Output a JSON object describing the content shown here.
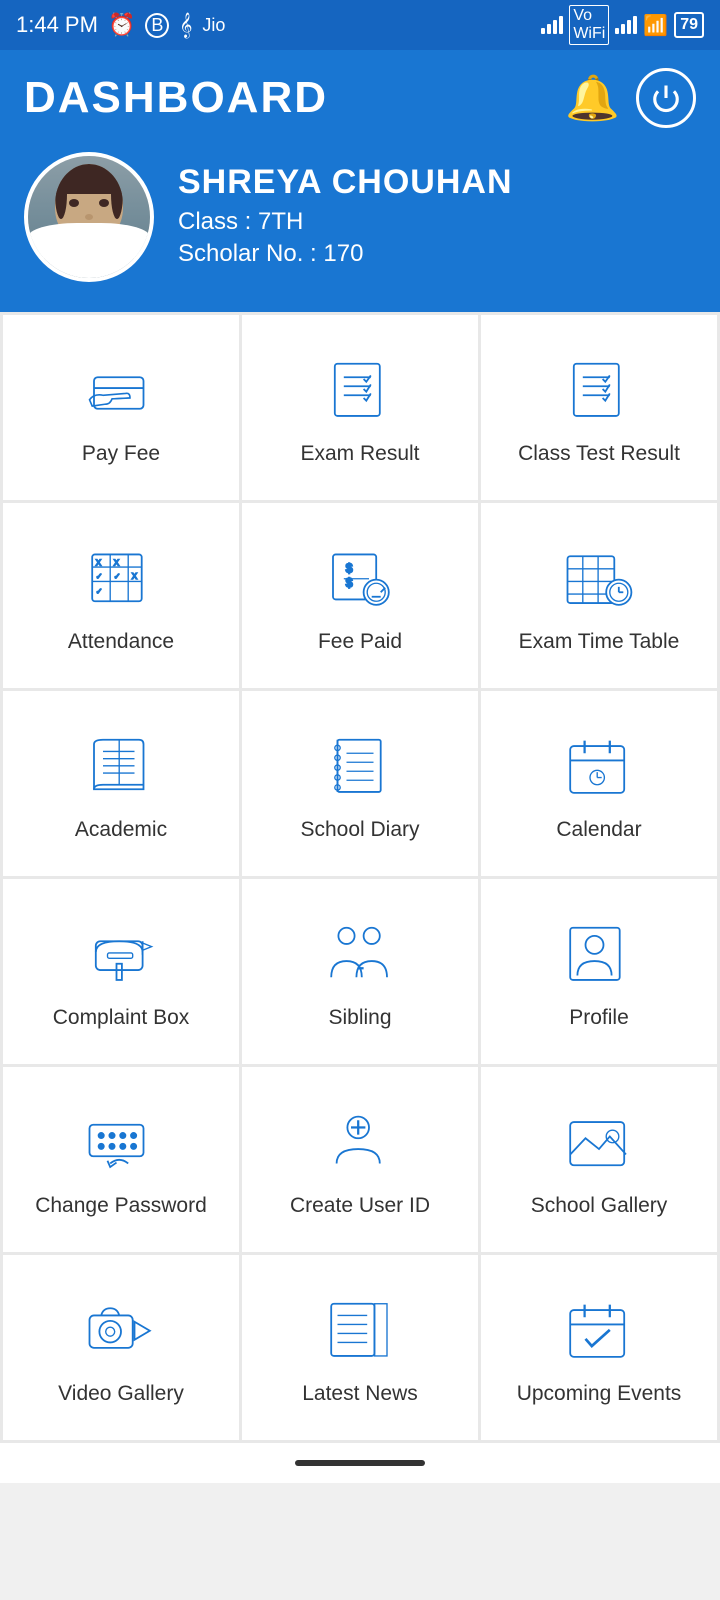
{
  "statusBar": {
    "time": "1:44 PM",
    "battery": "79"
  },
  "header": {
    "title": "DASHBOARD",
    "bell_label": "notifications",
    "power_label": "logout"
  },
  "profile": {
    "name": "SHREYA  CHOUHAN",
    "class_label": "Class : 7TH",
    "scholar_label": "Scholar No. : 170"
  },
  "grid": {
    "items": [
      {
        "id": "pay-fee",
        "label": "Pay Fee",
        "icon": "pay-fee"
      },
      {
        "id": "exam-result",
        "label": "Exam Result",
        "icon": "exam-result"
      },
      {
        "id": "class-test-result",
        "label": "Class Test Result",
        "icon": "class-test-result"
      },
      {
        "id": "attendance",
        "label": "Attendance",
        "icon": "attendance"
      },
      {
        "id": "fee-paid",
        "label": "Fee Paid",
        "icon": "fee-paid"
      },
      {
        "id": "exam-time-table",
        "label": "Exam Time Table",
        "icon": "exam-time-table"
      },
      {
        "id": "academic",
        "label": "Academic",
        "icon": "academic"
      },
      {
        "id": "school-diary",
        "label": "School Diary",
        "icon": "school-diary"
      },
      {
        "id": "calendar",
        "label": "Calendar",
        "icon": "calendar"
      },
      {
        "id": "complaint-box",
        "label": "Complaint Box",
        "icon": "complaint-box"
      },
      {
        "id": "sibling",
        "label": "Sibling",
        "icon": "sibling"
      },
      {
        "id": "profile",
        "label": "Profile",
        "icon": "profile"
      },
      {
        "id": "change-password",
        "label": "Change Password",
        "icon": "change-password"
      },
      {
        "id": "create-user-id",
        "label": "Create User ID",
        "icon": "create-user-id"
      },
      {
        "id": "school-gallery",
        "label": "School Gallery",
        "icon": "school-gallery"
      },
      {
        "id": "video-gallery",
        "label": "Video Gallery",
        "icon": "video-gallery"
      },
      {
        "id": "latest-news",
        "label": "Latest News",
        "icon": "latest-news"
      },
      {
        "id": "upcoming-events",
        "label": "Upcoming Events",
        "icon": "upcoming-events"
      }
    ]
  },
  "colors": {
    "primary": "#1976d2",
    "header_bg": "#1976d2",
    "icon_color": "#1976d2"
  }
}
